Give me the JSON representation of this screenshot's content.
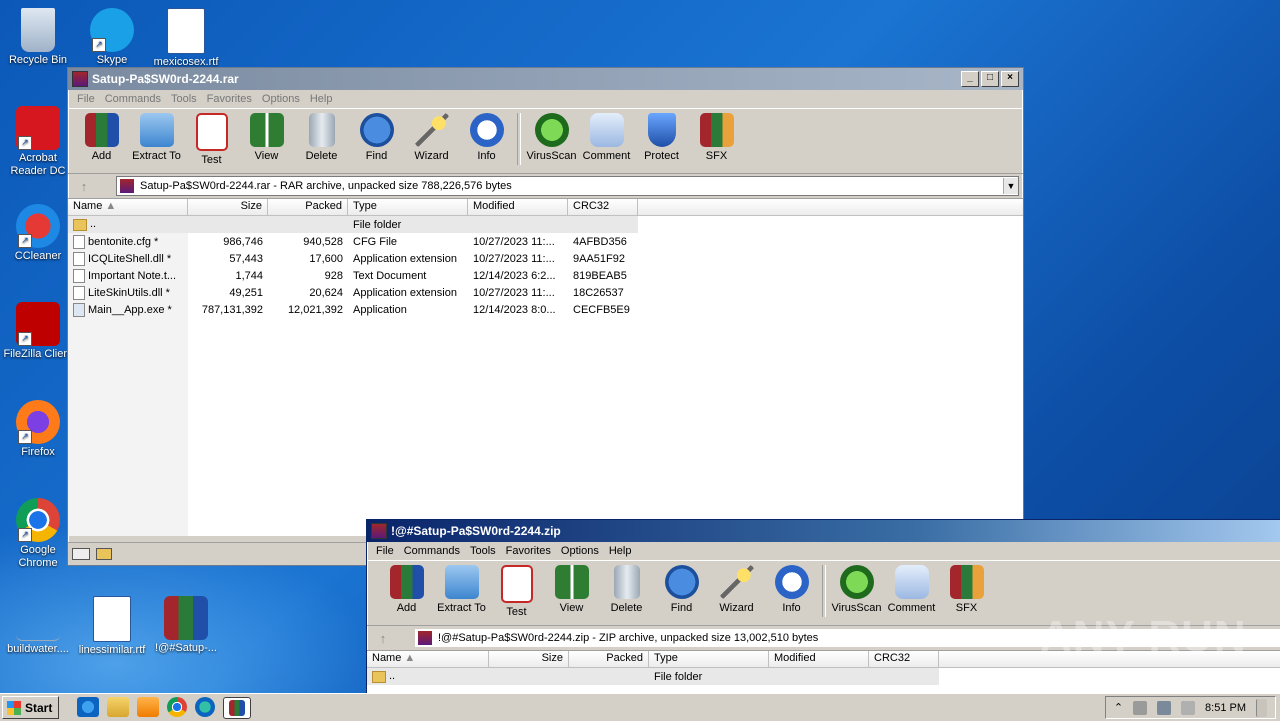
{
  "desktop": {
    "icons": [
      {
        "label": "Recycle Bin"
      },
      {
        "label": "Skype"
      },
      {
        "label": "mexicosex.rtf"
      },
      {
        "label": "Acrobat Reader DC"
      },
      {
        "label": "CCleaner"
      },
      {
        "label": "FileZilla Client"
      },
      {
        "label": "Firefox"
      },
      {
        "label": "Google Chrome"
      },
      {
        "label": "buildwater...."
      },
      {
        "label": "linessimilar.rtf"
      },
      {
        "label": "!@#Satup-..."
      }
    ],
    "watermark": "ANY RUN"
  },
  "win1": {
    "title": "Satup-Pa$SW0rd-2244.rar",
    "menu": [
      "File",
      "Commands",
      "Tools",
      "Favorites",
      "Options",
      "Help"
    ],
    "tools": [
      "Add",
      "Extract To",
      "Test",
      "View",
      "Delete",
      "Find",
      "Wizard",
      "Info",
      "VirusScan",
      "Comment",
      "Protect",
      "SFX"
    ],
    "address": "Satup-Pa$SW0rd-2244.rar - RAR archive, unpacked size 788,226,576 bytes",
    "columns": {
      "name": "Name",
      "size": "Size",
      "packed": "Packed",
      "type": "Type",
      "modified": "Modified",
      "crc": "CRC32"
    },
    "rows": [
      {
        "name": "..",
        "size": "",
        "packed": "",
        "type": "File folder",
        "modified": "",
        "crc": ""
      },
      {
        "name": "bentonite.cfg *",
        "size": "986,746",
        "packed": "940,528",
        "type": "CFG File",
        "modified": "10/27/2023 11:...",
        "crc": "4AFBD356"
      },
      {
        "name": "ICQLiteShell.dll *",
        "size": "57,443",
        "packed": "17,600",
        "type": "Application extension",
        "modified": "10/27/2023 11:...",
        "crc": "9AA51F92"
      },
      {
        "name": "Important Note.t...",
        "size": "1,744",
        "packed": "928",
        "type": "Text Document",
        "modified": "12/14/2023 6:2...",
        "crc": "819BEAB5"
      },
      {
        "name": "LiteSkinUtils.dll *",
        "size": "49,251",
        "packed": "20,624",
        "type": "Application extension",
        "modified": "10/27/2023 11:...",
        "crc": "18C26537"
      },
      {
        "name": "Main__App.exe *",
        "size": "787,131,392",
        "packed": "12,021,392",
        "type": "Application",
        "modified": "12/14/2023 8:0...",
        "crc": "CECFB5E9"
      }
    ]
  },
  "win2": {
    "title": "!@#Satup-Pa$SW0rd-2244.zip",
    "menu": [
      "File",
      "Commands",
      "Tools",
      "Favorites",
      "Options",
      "Help"
    ],
    "tools": [
      "Add",
      "Extract To",
      "Test",
      "View",
      "Delete",
      "Find",
      "Wizard",
      "Info",
      "VirusScan",
      "Comment",
      "SFX"
    ],
    "address": "!@#Satup-Pa$SW0rd-2244.zip - ZIP archive, unpacked size 13,002,510 bytes",
    "columns": {
      "name": "Name",
      "size": "Size",
      "packed": "Packed",
      "type": "Type",
      "modified": "Modified",
      "crc": "CRC32"
    },
    "rows": [
      {
        "name": "..",
        "type": "File folder"
      }
    ]
  },
  "taskbar": {
    "start": "Start",
    "clock": "8:51 PM"
  }
}
